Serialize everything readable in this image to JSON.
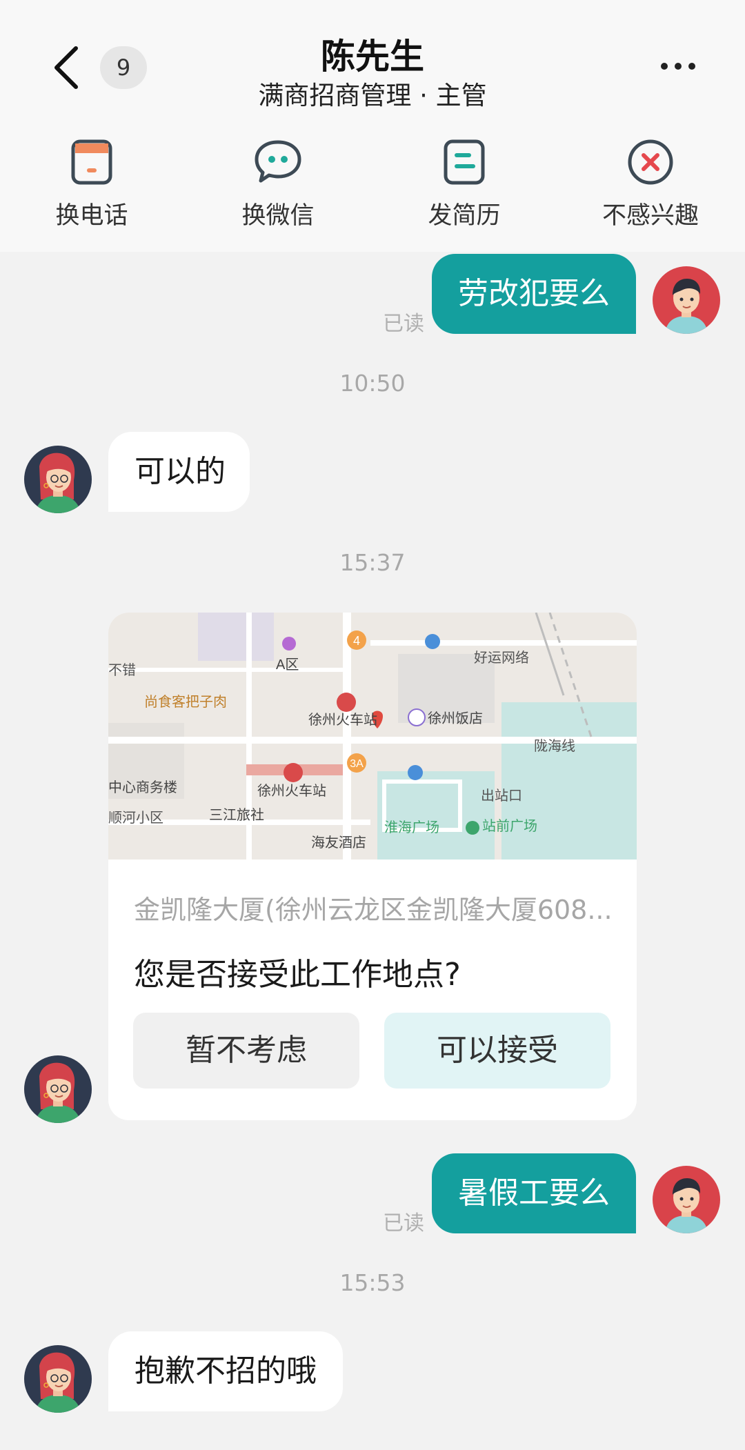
{
  "header": {
    "unread_count": "9",
    "title": "陈先生",
    "subtitle": "满商招商管理 · 主管"
  },
  "actions": [
    {
      "label": "换电话",
      "icon": "phone-card-icon"
    },
    {
      "label": "换微信",
      "icon": "wechat-icon"
    },
    {
      "label": "发简历",
      "icon": "resume-icon"
    },
    {
      "label": "不感兴趣",
      "icon": "not-interested-icon"
    }
  ],
  "messages": {
    "m1": {
      "text": "劳改犯要么",
      "status": "已读"
    },
    "t1": "10:50",
    "m2": {
      "text": "可以的"
    },
    "t2": "15:37",
    "location_card": {
      "address": "金凯隆大厦(徐州云龙区金凯隆大厦608...",
      "question": "您是否接受此工作地点?",
      "decline_label": "暂不考虑",
      "accept_label": "可以接受",
      "map_labels": {
        "a_zone": "A区",
        "haoyun": "好运网络",
        "shangshi": "尚食客把子肉",
        "station_top": "徐州火车站",
        "hotel": "徐州饭店",
        "mall_left": "中心商务楼",
        "station": "徐州火车站",
        "shunhe": "顺河小区",
        "sanjiang": "三江旅社",
        "haiyou": "海友酒店",
        "huaihai": "淮海广场",
        "zhanqian": "站前广场",
        "exit": "出站口",
        "longhai": "陇海线",
        "cuo": "不错",
        "num4": "4",
        "num3a": "3A"
      }
    },
    "m3": {
      "text": "暑假工要么",
      "status": "已读"
    },
    "t3": "15:53",
    "m4": {
      "text": "抱歉不招的哦"
    }
  },
  "colors": {
    "accent": "#149f9e",
    "background": "#f2f2f2"
  }
}
